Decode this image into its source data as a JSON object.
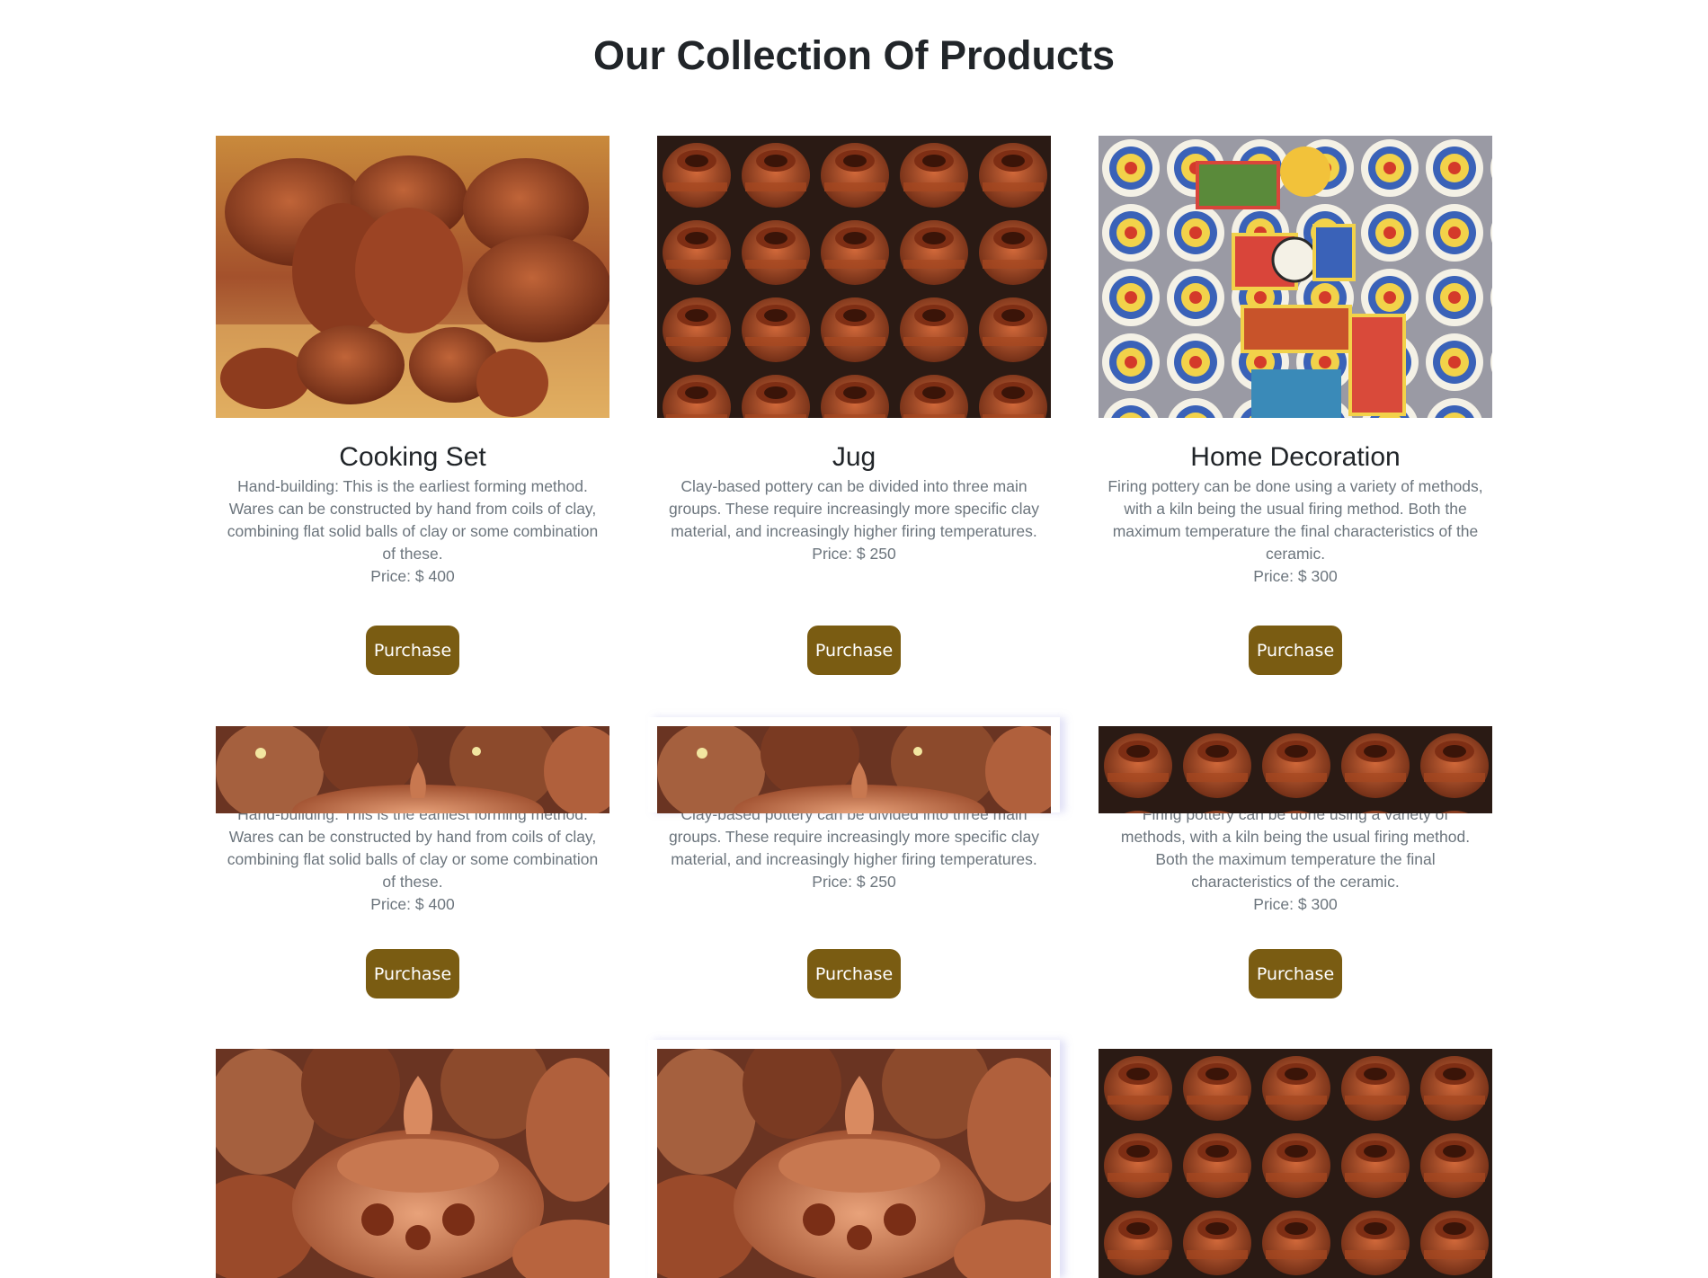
{
  "page": {
    "title": "Our Collection Of Products"
  },
  "row1": [
    {
      "image": "terracotta-cooking-set-photo",
      "name": "Cooking Set",
      "description": "Hand-building: This is the earliest forming method. Wares can be constructed by hand from coils of clay, combining flat solid balls of clay or some combination of these.",
      "price": "Price: $ 400",
      "button": "Purchase"
    },
    {
      "image": "clay-jugs-photo",
      "name": "Jug",
      "description": "Clay-based pottery can be divided into three main groups. These require increasingly more specific clay material, and increasingly higher firing temperatures.",
      "price": "Price: $ 250",
      "button": "Purchase"
    },
    {
      "image": "painted-ceramic-plates-photo",
      "name": "Home Decoration",
      "description": "Firing pottery can be done using a variety of methods, with a kiln being the usual firing method. Both the maximum temperature the final characteristics of the ceramic.",
      "price": "Price: $ 300",
      "button": "Purchase"
    }
  ],
  "row2": [
    {
      "image": "carved-terracotta-pot-photo",
      "description_visible": "Wares can be constructed by hand from coils of clay, combining flat solid balls of clay or some combination of these.",
      "description_clipped": "Hand-building: This is the earliest forming method.",
      "price": "Price: $ 400",
      "button": "Purchase"
    },
    {
      "image": "carved-terracotta-pot-photo",
      "description_visible": "groups. These require increasingly more specific clay material, and increasingly higher firing temperatures.",
      "description_clipped": "Clay-based pottery can be divided into three main",
      "price": "Price: $ 250",
      "button": "Purchase"
    },
    {
      "image": "clay-jugs-photo",
      "description_visible": "methods, with a kiln being the usual firing method. Both the maximum temperature the final characteristics of the ceramic.",
      "description_clipped": "Firing pottery can be done using a variety of",
      "price": "Price: $ 300",
      "button": "Purchase"
    }
  ],
  "row3": [
    {
      "image": "carved-terracotta-pot-photo"
    },
    {
      "image": "carved-terracotta-pot-photo"
    },
    {
      "image": "clay-jugs-photo"
    }
  ],
  "colors": {
    "button_bg": "#7a5c12",
    "button_text": "#ffffff",
    "title": "#212529",
    "muted_text": "#6c757d"
  }
}
